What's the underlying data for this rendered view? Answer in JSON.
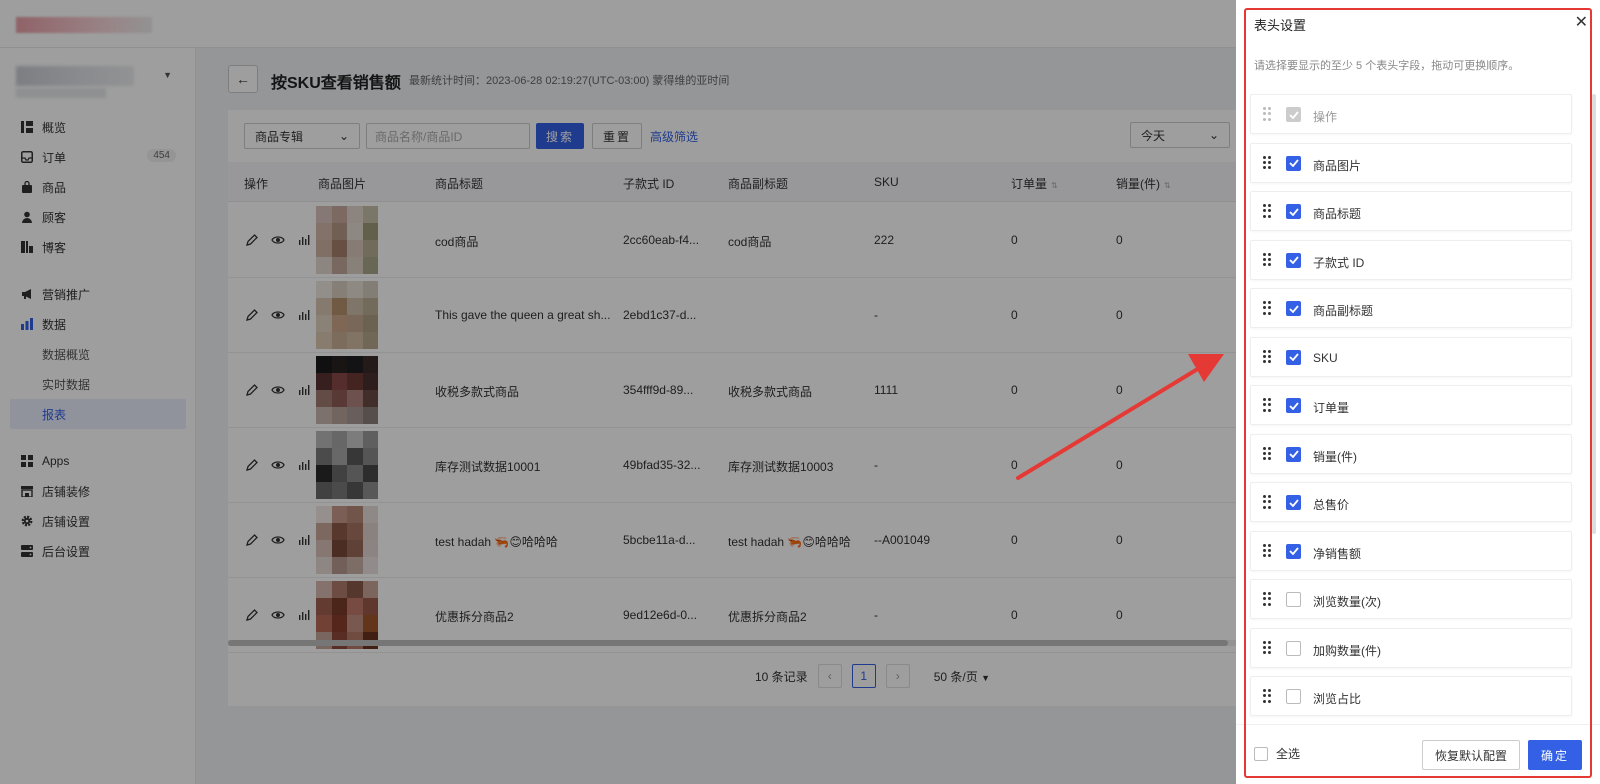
{
  "sidebar": {
    "nav_top": [
      {
        "icon": "dashboard-icon",
        "label": "概览"
      },
      {
        "icon": "inbox-icon",
        "label": "订单",
        "badge": "454"
      },
      {
        "icon": "bag-icon",
        "label": "商品"
      },
      {
        "icon": "user-icon",
        "label": "顾客"
      },
      {
        "icon": "blog-icon",
        "label": "博客"
      }
    ],
    "nav_mid": [
      {
        "icon": "megaphone-icon",
        "label": "营销推广"
      },
      {
        "icon": "bar-chart-icon",
        "label": "数据"
      }
    ],
    "nav_sub": [
      "数据概览",
      "实时数据",
      "报表"
    ],
    "nav_bottom": [
      {
        "icon": "apps-icon",
        "label": "Apps"
      },
      {
        "icon": "store-icon",
        "label": "店铺装修"
      },
      {
        "icon": "gear-icon",
        "label": "店铺设置"
      },
      {
        "icon": "server-icon",
        "label": "后台设置"
      }
    ]
  },
  "page": {
    "title": "按SKU查看销售额",
    "stat_time": "最新统计时间：2023-06-28 02:19:27(UTC-03:00) 蒙得维的亚时间"
  },
  "filters": {
    "select_value": "商品专辑",
    "search_placeholder": "商品名称/商品ID",
    "search_label": "搜索",
    "reset_label": "重置",
    "advanced_label": "高级筛选",
    "date_value": "今天"
  },
  "table": {
    "headers": {
      "ops": "操作",
      "image": "商品图片",
      "title": "商品标题",
      "variant_id": "子款式 ID",
      "subtitle": "商品副标题",
      "sku": "SKU",
      "orders": "订单量",
      "sales": "销量(件)"
    },
    "rows": [
      {
        "title": "cod商品",
        "variant_id": "2cc60eab-f4...",
        "subtitle": "cod商品",
        "sku": "222",
        "orders": "0",
        "sales": "0"
      },
      {
        "title": "This gave the queen a great sh...",
        "variant_id": "2ebd1c37-d...",
        "subtitle": "",
        "sku": "-",
        "orders": "0",
        "sales": "0"
      },
      {
        "title": "收税多款式商品",
        "variant_id": "354fff9d-89...",
        "subtitle": "收税多款式商品",
        "sku": "1111",
        "orders": "0",
        "sales": "0"
      },
      {
        "title": "库存测试数据10001",
        "variant_id": "49bfad35-32...",
        "subtitle": "库存测试数据10003",
        "sku": "-",
        "orders": "0",
        "sales": "0"
      },
      {
        "title": "test hadah 🦐😊哈哈哈",
        "variant_id": "5bcbe11a-d...",
        "subtitle": "test hadah 🦐😊哈哈哈",
        "sku": "--A001049",
        "orders": "0",
        "sales": "0"
      },
      {
        "title": "优惠拆分商品2",
        "variant_id": "9ed12e6d-0...",
        "subtitle": "优惠拆分商品2",
        "sku": "-",
        "orders": "0",
        "sales": "0"
      }
    ]
  },
  "pagination": {
    "total": "10 条记录",
    "current": "1",
    "page_size": "50 条/页"
  },
  "drawer": {
    "title": "表头设置",
    "tip": "请选择要显示的至少 5 个表头字段，拖动可更换顺序。",
    "columns": [
      {
        "label": "操作",
        "checked": true,
        "disabled": true
      },
      {
        "label": "商品图片",
        "checked": true,
        "disabled": false
      },
      {
        "label": "商品标题",
        "checked": true,
        "disabled": false
      },
      {
        "label": "子款式 ID",
        "checked": true,
        "disabled": false
      },
      {
        "label": "商品副标题",
        "checked": true,
        "disabled": false
      },
      {
        "label": "SKU",
        "checked": true,
        "disabled": false
      },
      {
        "label": "订单量",
        "checked": true,
        "disabled": false
      },
      {
        "label": "销量(件)",
        "checked": true,
        "disabled": false
      },
      {
        "label": "总售价",
        "checked": true,
        "disabled": false
      },
      {
        "label": "净销售额",
        "checked": true,
        "disabled": false
      },
      {
        "label": "浏览数量(次)",
        "checked": false,
        "disabled": false
      },
      {
        "label": "加购数量(件)",
        "checked": false,
        "disabled": false
      },
      {
        "label": "浏览占比",
        "checked": false,
        "disabled": false
      }
    ],
    "select_all_label": "全选",
    "restore_label": "恢复默认配置",
    "confirm_label": "确定"
  },
  "colors": {
    "primary": "#3360e5",
    "annotation_red": "#e53935"
  }
}
